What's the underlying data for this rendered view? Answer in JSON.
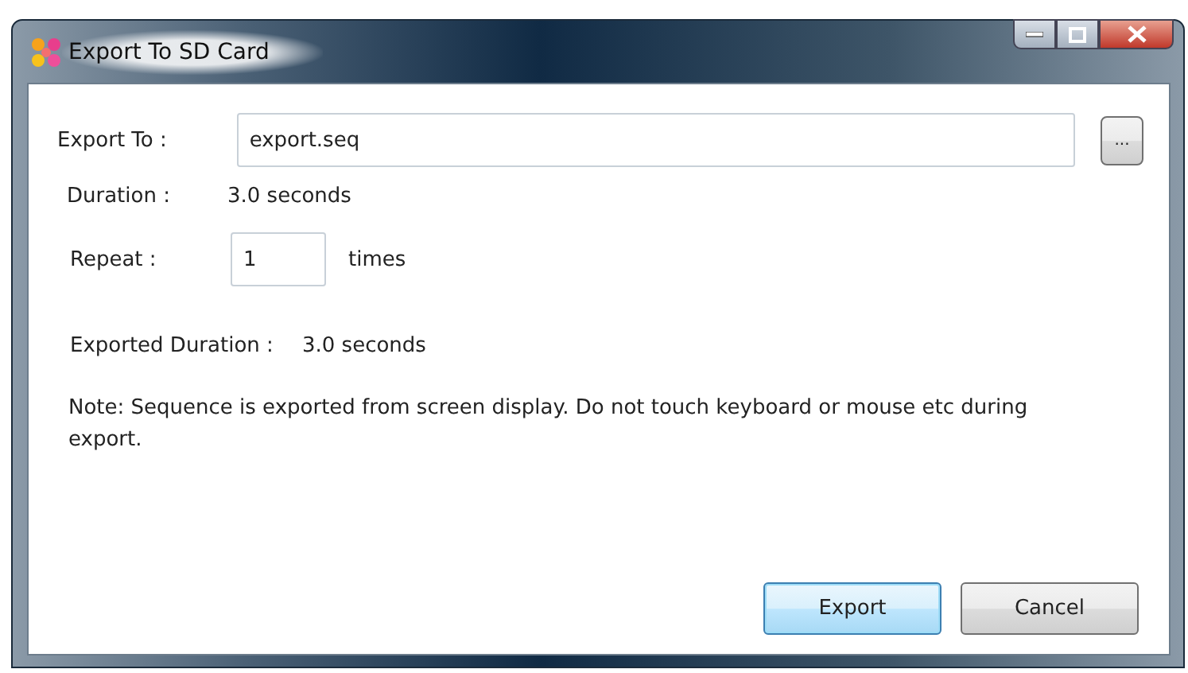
{
  "window": {
    "title": "Export To SD Card"
  },
  "export_to": {
    "label": "Export To :",
    "value": "export.seq",
    "browse_button": "..."
  },
  "duration": {
    "label": "Duration :",
    "value": "3.0 seconds"
  },
  "repeat": {
    "label": "Repeat :",
    "value": "1",
    "unit": "times"
  },
  "exported_duration": {
    "label": "Exported Duration :",
    "value": "3.0 seconds"
  },
  "note": "Note: Sequence is exported from screen display. Do not touch keyboard or mouse etc during export.",
  "buttons": [
    {
      "label": "Export",
      "default": true
    },
    {
      "label": "Cancel",
      "default": false
    }
  ]
}
